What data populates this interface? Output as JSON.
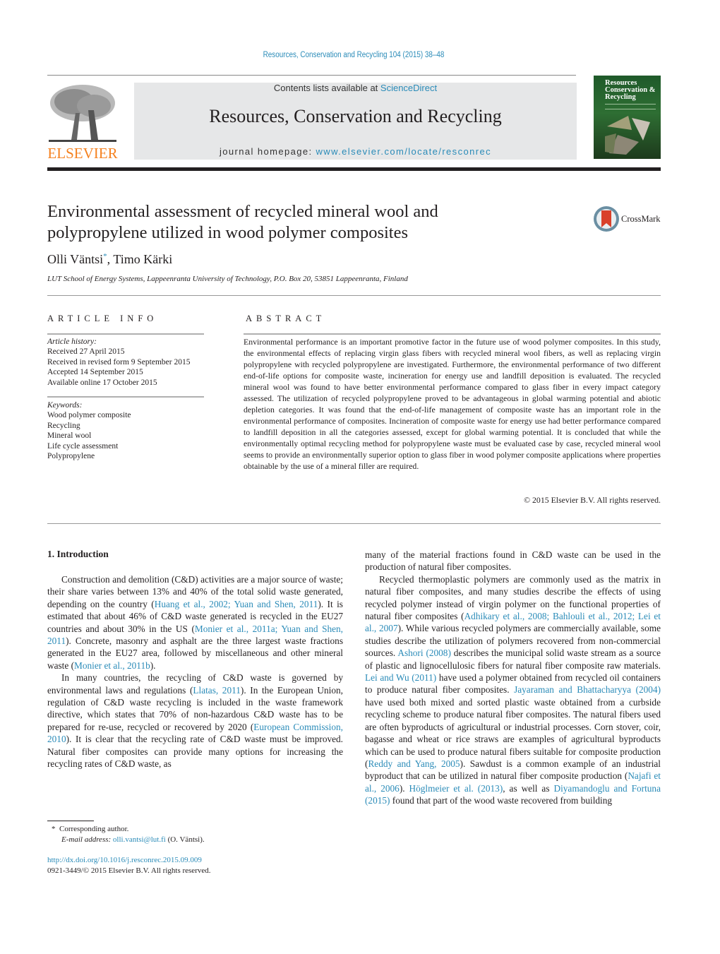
{
  "header": {
    "journal_reference": "Resources, Conservation and Recycling 104 (2015) 38–48",
    "contents_prefix": "Contents lists available at ",
    "contents_link": "ScienceDirect",
    "journal_title": "Resources, Conservation and Recycling",
    "homepage_prefix": "journal homepage: ",
    "homepage_link": "www.elsevier.com/locate/resconrec",
    "publisher_logo_text": "ELSEVIER",
    "cover_title_lines": [
      "Resources",
      "Conservation &",
      "Recycling"
    ],
    "colors": {
      "link": "#2a8bb8",
      "elsevier_orange": "#f58220",
      "banner_gray": "#e6e7e8"
    }
  },
  "article": {
    "title_line1": "Environmental assessment of recycled mineral wool and",
    "title_line2": "polypropylene utilized in wood polymer composites",
    "crossmark_label": "CrossMark",
    "author1": "Olli Väntsi",
    "author1_mark": "*",
    "author_sep": ", ",
    "author2": "Timo Kärki",
    "affiliation": "LUT School of Energy Systems, Lappeenranta University of Technology, P.O. Box 20, 53851 Lappeenranta, Finland"
  },
  "article_info": {
    "heading": "ARTICLE INFO",
    "history_label": "Article history:",
    "history": [
      "Received 27 April 2015",
      "Received in revised form 9 September 2015",
      "Accepted 14 September 2015",
      "Available online 17 October 2015"
    ],
    "keywords_label": "Keywords:",
    "keywords": [
      "Wood polymer composite",
      "Recycling",
      "Mineral wool",
      "Life cycle assessment",
      "Polypropylene"
    ]
  },
  "abstract": {
    "heading": "ABSTRACT",
    "text": "Environmental performance is an important promotive factor in the future use of wood polymer composites. In this study, the environmental effects of replacing virgin glass fibers with recycled mineral wool fibers, as well as replacing virgin polypropylene with recycled polypropylene are investigated. Furthermore, the environmental performance of two different end-of-life options for composite waste, incineration for energy use and landfill deposition is evaluated. The recycled mineral wool was found to have better environmental performance compared to glass fiber in every impact category assessed. The utilization of recycled polypropylene proved to be advantageous in global warming potential and abiotic depletion categories. It was found that the end-of-life management of composite waste has an important role in the environmental performance of composites. Incineration of composite waste for energy use had better performance compared to landfill deposition in all the categories assessed, except for global warming potential. It is concluded that while the environmentally optimal recycling method for polypropylene waste must be evaluated case by case, recycled mineral wool seems to provide an environmentally superior option to glass fiber in wood polymer composite applications where properties obtainable by the use of a mineral filler are required.",
    "copyright": "© 2015 Elsevier B.V. All rights reserved."
  },
  "body": {
    "section1_heading": "1.  Introduction",
    "p1": [
      {
        "t": "Construction and demolition (C&D) activities are a major source of waste; their share varies between 13% and 40% of the total solid waste generated, depending on the country ("
      },
      {
        "l": "Huang et al., 2002; Yuan and Shen, 2011"
      },
      {
        "t": "). It is estimated that about 46% of C&D waste generated is recycled in the EU27 countries and about 30% in the US ("
      },
      {
        "l": "Monier et al., 2011a; Yuan and Shen, 2011"
      },
      {
        "t": "). Concrete, masonry and asphalt are the three largest waste fractions generated in the EU27 area, followed by miscellaneous and other mineral waste ("
      },
      {
        "l": "Monier et al., 2011b"
      },
      {
        "t": ")."
      }
    ],
    "p2": [
      {
        "t": "In many countries, the recycling of C&D waste is governed by environmental laws and regulations ("
      },
      {
        "l": "Llatas, 2011"
      },
      {
        "t": "). In the European Union, regulation of C&D waste recycling is included in the waste framework directive, which states that 70% of non-hazardous C&D waste has to be prepared for re-use, recycled or recovered by 2020 ("
      },
      {
        "l": "European Commission, 2010"
      },
      {
        "t": "). It is clear that the recycling rate of C&D waste must be improved. Natural fiber composites can provide many options for increasing the recycling rates of C&D waste, as"
      }
    ],
    "p2_cont": "many of the material fractions found in C&D waste can be used in the production of natural fiber composites.",
    "p3": [
      {
        "t": "Recycled thermoplastic polymers are commonly used as the matrix in natural fiber composites, and many studies describe the effects of using recycled polymer instead of virgin polymer on the functional properties of natural fiber composites ("
      },
      {
        "l": "Adhikary et al., 2008; Bahlouli et al., 2012; Lei et al., 2007"
      },
      {
        "t": "). While various recycled polymers are commercially available, some studies describe the utilization of polymers recovered from non-commercial sources. "
      },
      {
        "l": "Ashori (2008)"
      },
      {
        "t": " describes the municipal solid waste stream as a source of plastic and lignocellulosic fibers for natural fiber composite raw materials. "
      },
      {
        "l": "Lei and Wu (2011)"
      },
      {
        "t": " have used a polymer obtained from recycled oil containers to produce natural fiber composites. "
      },
      {
        "l": "Jayaraman and Bhattacharyya (2004)"
      },
      {
        "t": " have used both mixed and sorted plastic waste obtained from a curbside recycling scheme to produce natural fiber composites. The natural fibers used are often byproducts of agricultural or industrial processes. Corn stover, coir, bagasse and wheat or rice straws are examples of agricultural byproducts which can be used to produce natural fibers suitable for composite production ("
      },
      {
        "l": "Reddy and Yang, 2005"
      },
      {
        "t": "). Sawdust is a common example of an industrial byproduct that can be utilized in natural fiber composite production ("
      },
      {
        "l": "Najafi et al., 2006"
      },
      {
        "t": "). "
      },
      {
        "l": "Höglmeier et al. (2013)"
      },
      {
        "t": ", as well as "
      },
      {
        "l": "Diyamandoglu and Fortuna (2015)"
      },
      {
        "t": " found that part of the wood waste recovered from building"
      }
    ]
  },
  "footnotes": {
    "corresponding_mark": "*",
    "corresponding_label": "Corresponding author.",
    "email_label": "E-mail address:",
    "email": "olli.vantsi@lut.fi",
    "email_suffix": " (O. Väntsi).",
    "doi": "http://dx.doi.org/10.1016/j.resconrec.2015.09.009",
    "issn_copyright": "0921-3449/© 2015 Elsevier B.V. All rights reserved."
  }
}
